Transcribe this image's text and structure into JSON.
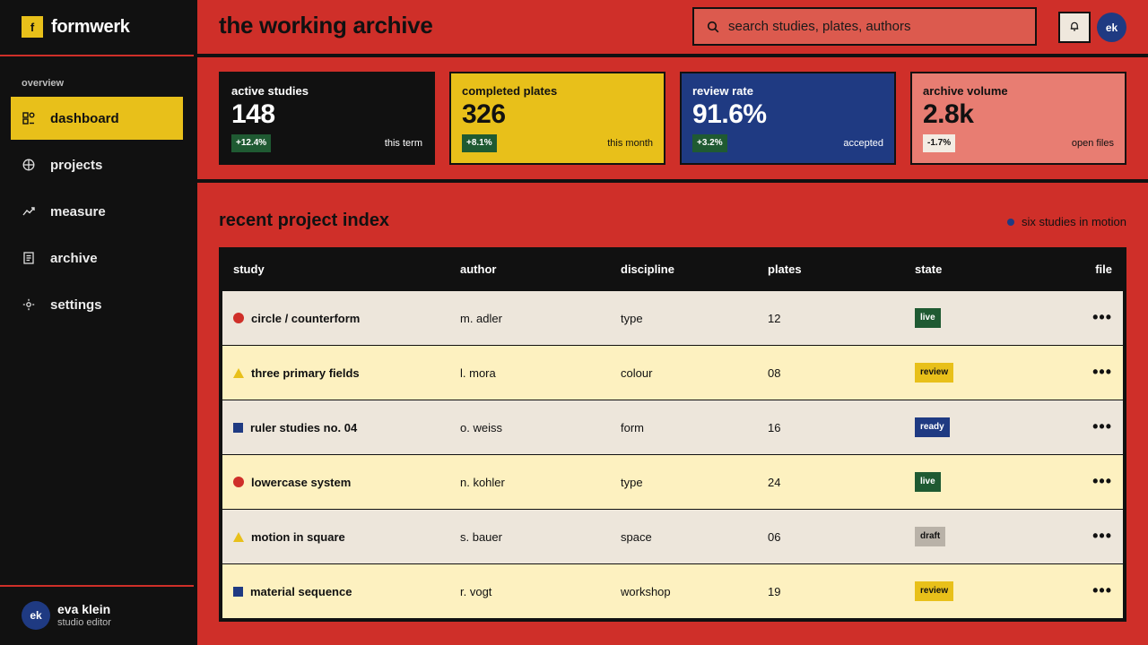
{
  "sidebar": {
    "brand": {
      "logo_letter": "f",
      "name": "formwerk"
    },
    "section_label": "overview",
    "items": [
      {
        "label": "dashboard",
        "icon": "dashboard-icon",
        "active": true
      },
      {
        "label": "projects",
        "icon": "projects-icon"
      },
      {
        "label": "measure",
        "icon": "measure-icon"
      },
      {
        "label": "archive",
        "icon": "archive-icon"
      },
      {
        "label": "settings",
        "icon": "settings-icon"
      }
    ],
    "user": {
      "initials": "ek",
      "name": "eva klein",
      "role": "studio editor"
    }
  },
  "header": {
    "title": "the working archive",
    "search_placeholder": "search studies, plates, authors",
    "avatar_initials": "ek"
  },
  "metrics": [
    {
      "label": "active studies",
      "value": "148",
      "delta": "+12.4%",
      "note": "this term"
    },
    {
      "label": "completed plates",
      "value": "326",
      "delta": "+8.1%",
      "note": "this month"
    },
    {
      "label": "review rate",
      "value": "91.6%",
      "delta": "+3.2%",
      "note": "accepted"
    },
    {
      "label": "archive volume",
      "value": "2.8k",
      "delta": "-1.7%",
      "note": "open files"
    }
  ],
  "table": {
    "title": "recent project index",
    "legend": "six studies in motion",
    "columns": {
      "study": "study",
      "author": "author",
      "discipline": "discipline",
      "plates": "plates",
      "state": "state",
      "file": "file"
    },
    "rows": [
      {
        "shape": "circle",
        "study": "circle / counterform",
        "author": "m. adler",
        "discipline": "type",
        "plates": "12",
        "state": "live"
      },
      {
        "shape": "triangle",
        "study": "three primary fields",
        "author": "l. mora",
        "discipline": "colour",
        "plates": "08",
        "state": "review"
      },
      {
        "shape": "square",
        "study": "ruler studies no. 04",
        "author": "o. weiss",
        "discipline": "form",
        "plates": "16",
        "state": "ready"
      },
      {
        "shape": "circle",
        "study": "lowercase system",
        "author": "n. kohler",
        "discipline": "type",
        "plates": "24",
        "state": "live"
      },
      {
        "shape": "triangle",
        "study": "motion in square",
        "author": "s. bauer",
        "discipline": "space",
        "plates": "06",
        "state": "draft"
      },
      {
        "shape": "square",
        "study": "material sequence",
        "author": "r. vogt",
        "discipline": "workshop",
        "plates": "19",
        "state": "review"
      }
    ],
    "more_glyph": "•••"
  },
  "colors": {
    "red": "#cf2f29",
    "yellow": "#e8c01a",
    "blue": "#1f3a82",
    "black": "#111111",
    "green": "#1f5a32"
  }
}
